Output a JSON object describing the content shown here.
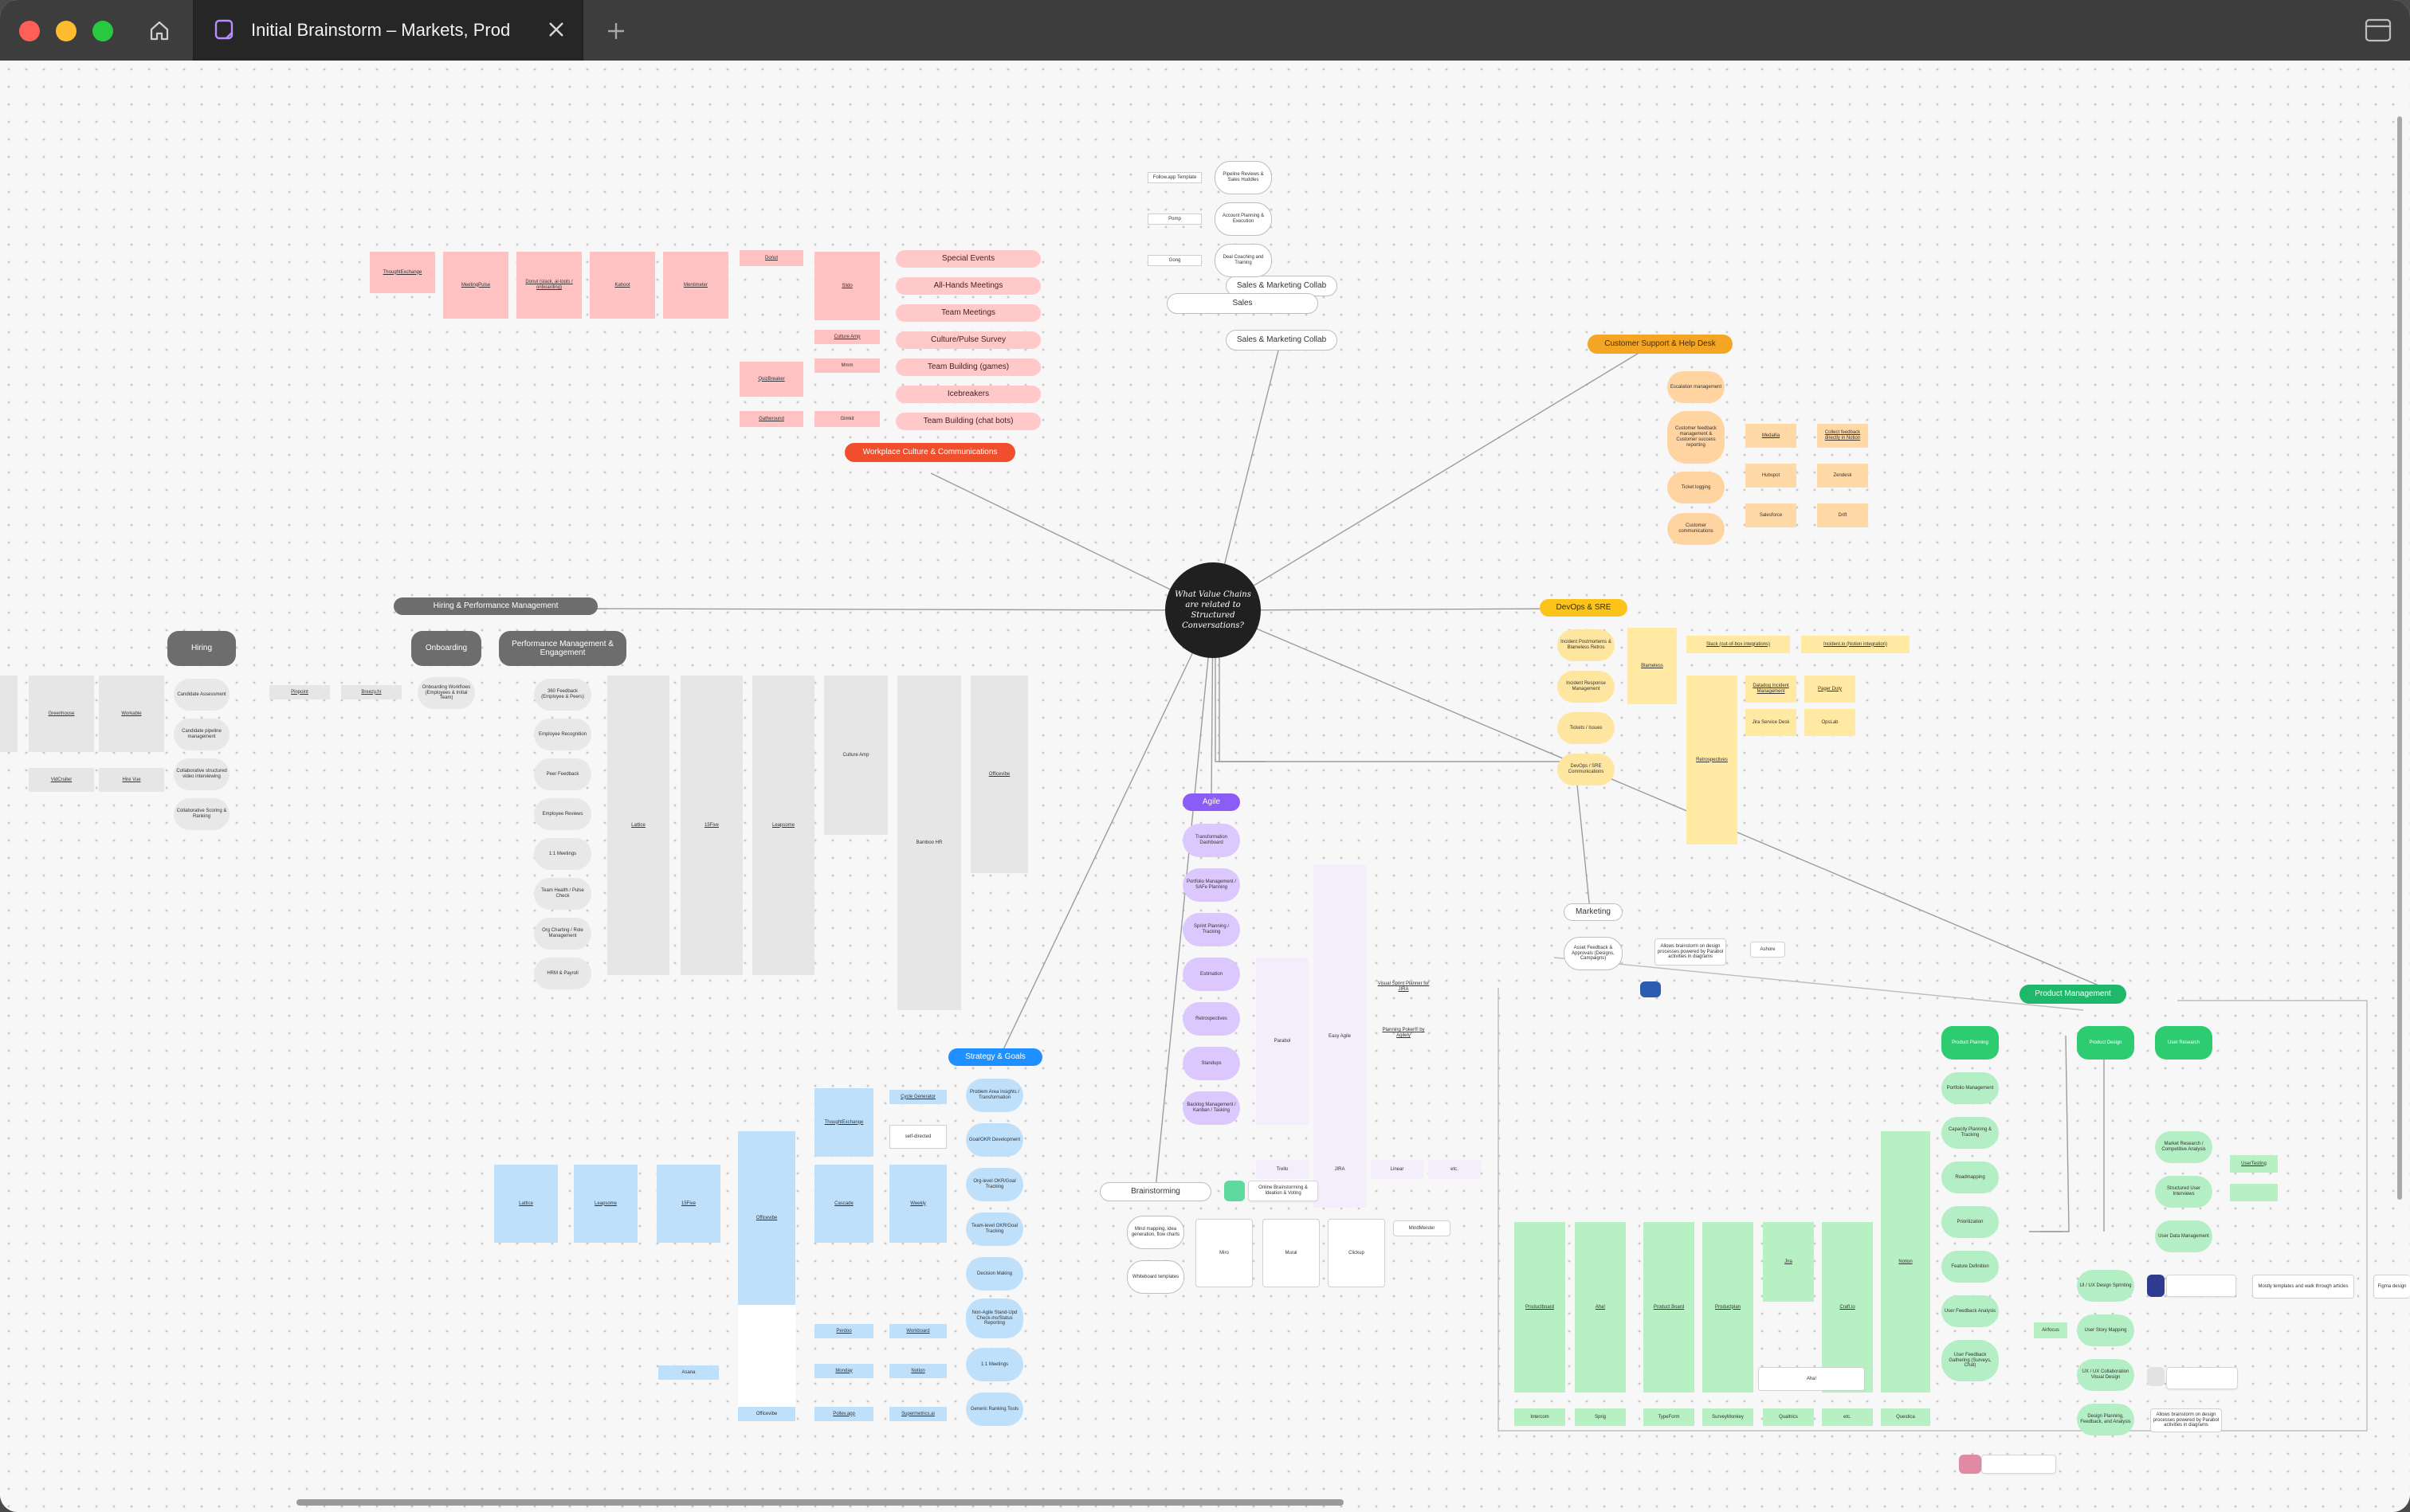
{
  "window": {
    "tab_title": "Initial Brainstorm – Markets, Prod"
  },
  "center": {
    "question": "What Value Chains are related to Structured Conversations?"
  },
  "sales": {
    "header": "Sales & Marketing Collab",
    "title": "Sales",
    "tools": [
      "Follow.app Template",
      "Pomp",
      "Gong"
    ],
    "topics": [
      "Pipeline Reviews & Sales Huddles",
      "Account Planning & Execution",
      "Deal Coaching and Training"
    ]
  },
  "culture": {
    "header": "Workplace Culture & Communications",
    "events": [
      "Special Events",
      "All-Hands Meetings",
      "Team Meetings",
      "Culture/Pulse Survey",
      "Team Building (games)",
      "Icebreakers",
      "Team Building (chat bots)"
    ],
    "tools_top": [
      "ThoughtExchange",
      "MeetingPulse",
      "Donut (slack, ai-tools / onboarding)",
      "Kahoot",
      "Mentimeter"
    ],
    "small": [
      "Donut",
      "Slido",
      "Culture Amp",
      "QuizBreaker",
      "Mmm",
      "Gatheround",
      "Gimkit"
    ]
  },
  "support": {
    "header": "Customer Support & Help Desk",
    "topics": [
      "Escalation management",
      "Customer feedback management & Customer success reporting",
      "Ticket logging",
      "Customer communications"
    ],
    "tools": [
      "Medallia",
      "Collect feedback directly in Notion",
      "Hubspot",
      "Zendesk",
      "Salesforce",
      "Drift"
    ]
  },
  "devops": {
    "header": "DevOps & SRE",
    "topics": [
      "Incident Postmortems & Blameless Retros",
      "Incident Response Management",
      "Tickets / Issues",
      "DevOps / SRE Communications"
    ],
    "tools": [
      "Blameless",
      "Slack (out-of-box integrations)",
      "Incident.io (Notion integration)",
      "Retrospectives",
      "Datadog Incident Management",
      "Pager Duty",
      "Jira Service Desk",
      "OpsLab"
    ]
  },
  "hiring": {
    "group_header": "Hiring & Performance Management",
    "hiring": "Hiring",
    "onboarding": "Onboarding",
    "perf": "Performance Management & Engagement",
    "hiring_topics": [
      "Candidate Assessment",
      "Candidate pipeline management",
      "Collaborative structured video interviewing",
      "Collaborative Scoring & Ranking"
    ],
    "hiring_tools": [
      "Greenhouse",
      "Workable",
      "VidCruiter",
      "Hire Vue",
      "Pinpoint",
      "Breezy.hr"
    ],
    "onboarding_topics": [
      "Onboarding Workflows (Employees & Initial Team)"
    ],
    "perf_topics": [
      "360 Feedback (Employee & Peers)",
      "Employee Recognition",
      "Peer Feedback",
      "Employee Reviews",
      "1:1 Meetings",
      "Team Health / Pulse Check",
      "Org Charting / Role Management",
      "HRM & Payroll"
    ],
    "perf_tools": [
      "Lattice",
      "15Five",
      "Leapsome",
      "Culture Amp",
      "Bamboo HR",
      "Officevibe"
    ]
  },
  "agile": {
    "header": "Agile",
    "topics": [
      "Transformation Dashboard",
      "Portfolio Management / SAFe Planning",
      "Sprint Planning / Tracking",
      "Estimation",
      "Retrospectives",
      "Standups",
      "Backlog Management / Kanban / Tasking"
    ],
    "tools": [
      "Parabol",
      "Easy Agile",
      "Visual Sprint Planner for JIRA",
      "Planning Poker® by Agilely",
      "Trello",
      "JIRA",
      "Linear",
      "etc."
    ]
  },
  "strategy": {
    "header": "Strategy & Goals",
    "topics": [
      "Problem Area Insights / Transformation",
      "Goal/OKR Development",
      "Org-level OKR/Goal Tracking",
      "Team-level OKR/Goal Tracking",
      "Decision Making",
      "Non-Agile Stand-Upd Check-ins/Status Reporting",
      "1:1 Meetings",
      "Generic Ranking Tools"
    ],
    "tools": [
      "ThoughtExchange",
      "Cycle Generator",
      "self-directed",
      "Lattice",
      "Leapsome",
      "15Five",
      "Officevibe",
      "Cascade",
      "Weekly",
      "Perdoo",
      "Workboard",
      "Monday",
      "Notion",
      "Asana",
      "Gtmhub",
      "Range",
      "Pollev.app",
      "Supermetrics.ai"
    ]
  },
  "brainstorm": {
    "header": "Brainstorming",
    "topics": [
      "Mind mapping, idea generation, flow charts",
      "Whiteboard templates"
    ],
    "tools": [
      "Miro",
      "Mural",
      "Clickup",
      "MindMeister"
    ],
    "card": "Online Brainstorming & Ideation & Voting"
  },
  "marketing": {
    "header": "Marketing",
    "topics": [
      "Asset Feedback & Approvals (Designs, Campaigns)",
      "Allows brainstorm on design processes powered by Parabol activities in diagrams"
    ],
    "tool": "Ashore"
  },
  "product": {
    "header": "Product Management",
    "sections": [
      "Product Planning",
      "Product Design",
      "User Research"
    ],
    "planning": [
      "Portfolio Management",
      "Capacity Planning & Tracking",
      "Roadmapping",
      "Prioritization",
      "Feature Definition",
      "User Feedback Analysis",
      "User Feedback Gathering (Surveys, Chat)"
    ],
    "design": [
      "UI / UX Design Sprinting",
      "User Story Mapping",
      "UX / UX Collaboration Visual Design",
      "Design Planning, Feedback, and Analysis"
    ],
    "research": [
      "Market Research / Competitive Analysis",
      "Structured User Interviews",
      "User Data Management"
    ],
    "tools": [
      "Productboard",
      "Aha!",
      "Product Board",
      "Productplan",
      "Jira",
      "Craft.io",
      "Notion",
      "Airfocus",
      "Intercom",
      "Sprig",
      "TypeForm",
      "SurveyMonkey",
      "Qualtrics",
      "etc.",
      "Questica",
      "UserTesting"
    ],
    "cards": [
      "Mostly templates and walk through articles",
      "Figma design"
    ]
  },
  "colors": {
    "culture": "#f04e2c",
    "support": "#f5a524",
    "devops": "#fcc419",
    "agile": "#8c5cf6",
    "strategy": "#1e90ff",
    "product": "#1fb86a",
    "hiring": "#6d6d6d"
  }
}
